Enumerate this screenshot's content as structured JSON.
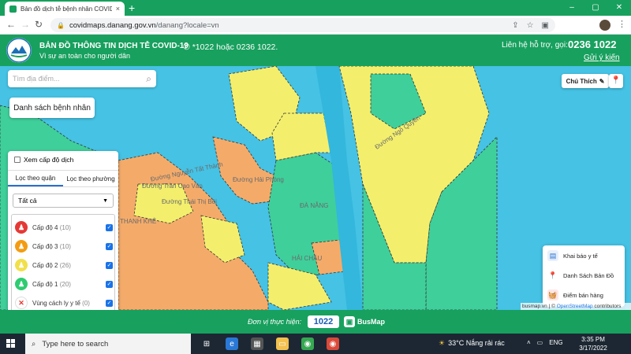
{
  "browser": {
    "tab_title": "Bản đồ dịch tễ bệnh nhân COVID",
    "tab_close": "×",
    "new_tab": "+",
    "url_host": "covidmaps.danang.gov.vn",
    "url_path": "/danang?locale=vn",
    "window_controls": [
      "–",
      "▢",
      "✕"
    ]
  },
  "header": {
    "title": "BẢN ĐỒ THÔNG TIN DỊCH TỄ COVID-19",
    "subtitle": "Vì sự an toàn cho người dân",
    "hotline": "*1022 hoặc 0236 1022.",
    "support_label": "Liên hệ hỗ trợ, gọi:",
    "support_phone": "0236 1022",
    "feedback_link": "Gửi ý kiến"
  },
  "map": {
    "search_placeholder": "Tìm địa điểm...",
    "patients_button": "Danh sách bệnh nhân",
    "legend_button": "Chú Thích",
    "labels": {
      "thanh_khe": "THANH KHÊ",
      "hai_chau": "HẢI CHÂU",
      "da_nang": "ĐÀ NẴNG",
      "street_1": "Đường Nguyễn Tất Thành",
      "street_2": "Đường Trần Cao Vân",
      "street_3": "Đường Thái Thị Bôi",
      "street_4": "Đường Ngô Quyền",
      "street_5": "Đường Hải Phòng"
    },
    "zone_colors": {
      "level4": "#e53935",
      "level3": "#f4a460",
      "level2": "#f3ef6d",
      "level1": "#3fcf9b",
      "water": "#45c2e4"
    }
  },
  "filter": {
    "toggle_label": "Xem cấp độ dịch",
    "tabs": [
      "Lọc theo quận",
      "Lọc theo phường"
    ],
    "select_value": "Tất cả",
    "levels": [
      {
        "label": "Cấp độ 4",
        "count": "(10)",
        "color": "#e53935",
        "icon": "person-icon"
      },
      {
        "label": "Cấp độ 3",
        "count": "(10)",
        "color": "#f39c12",
        "icon": "person-icon"
      },
      {
        "label": "Cấp độ 2",
        "count": "(26)",
        "color": "#f1e04a",
        "icon": "person-icon"
      },
      {
        "label": "Cấp độ 1",
        "count": "(20)",
        "color": "#2ecc71",
        "icon": "person-icon"
      },
      {
        "label": "Vùng cách ly y tế",
        "count": "(0)",
        "color": "#ffffff",
        "icon": "cross-icon"
      }
    ]
  },
  "right_panel": {
    "items": [
      "Khai báo y tế",
      "Danh Sách Bản Đồ",
      "Điểm bán hàng"
    ]
  },
  "attribution": {
    "source": "busmap.vn",
    "separator": "| ©",
    "osm": "OpenStreetMap",
    "suffix": "contributors"
  },
  "footer": {
    "partners_label": "Đơn vị thực hiện:",
    "partner_1": "1022",
    "partner_2": "BusMap"
  },
  "taskbar": {
    "search_placeholder": "Type here to search",
    "weather": "33°C  Nắng rải rác",
    "language": "ENG",
    "time": "3:35 PM",
    "date": "3/17/2022"
  }
}
